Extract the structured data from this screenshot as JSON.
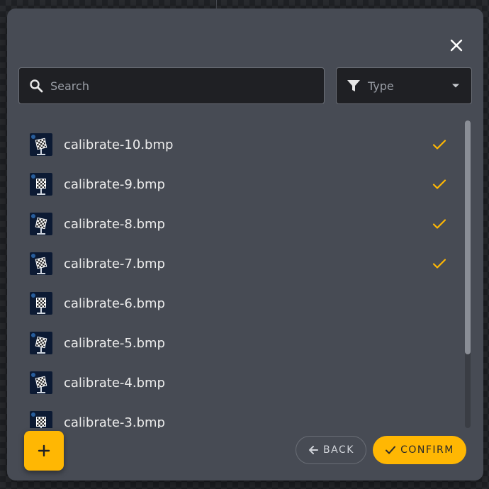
{
  "search": {
    "placeholder": "Search",
    "value": ""
  },
  "filter": {
    "label": "Type"
  },
  "files": [
    {
      "name": "calibrate-10.bmp",
      "selected": true
    },
    {
      "name": "calibrate-9.bmp",
      "selected": true
    },
    {
      "name": "calibrate-8.bmp",
      "selected": true
    },
    {
      "name": "calibrate-7.bmp",
      "selected": true
    },
    {
      "name": "calibrate-6.bmp",
      "selected": false
    },
    {
      "name": "calibrate-5.bmp",
      "selected": false
    },
    {
      "name": "calibrate-4.bmp",
      "selected": false
    },
    {
      "name": "calibrate-3.bmp",
      "selected": false
    }
  ],
  "actions": {
    "back_label": "BACK",
    "confirm_label": "CONFIRM"
  },
  "icons": {
    "close": "close-icon",
    "search": "search-icon",
    "filter": "filter-icon",
    "caret": "caret-down-icon",
    "check": "check-icon",
    "add": "plus-icon",
    "back": "arrow-left-icon",
    "confirm": "check-icon"
  },
  "colors": {
    "accent": "#ffb703",
    "dialog": "#474b54",
    "field": "#1f2024"
  }
}
